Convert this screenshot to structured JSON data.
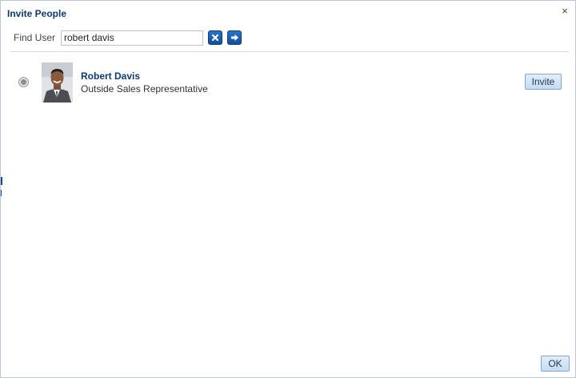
{
  "dialog": {
    "title": "Invite People",
    "close_symbol": "×"
  },
  "search": {
    "label": "Find User",
    "value": "robert davis",
    "clear_icon": "clear-icon",
    "go_icon": "arrow-right-icon"
  },
  "results": [
    {
      "name": "Robert Davis",
      "title": "Outside Sales Representative",
      "invite_label": "Invite"
    }
  ],
  "footer": {
    "ok_label": "OK"
  },
  "colors": {
    "title": "#0b3a6f",
    "icon_button": "#1a5fae",
    "button_bg": "#c6dbf1",
    "divider": "#d5dbe2"
  }
}
